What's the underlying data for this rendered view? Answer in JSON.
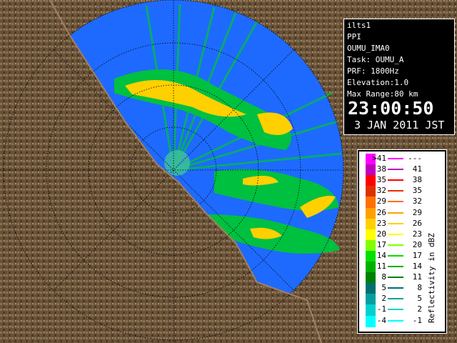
{
  "info": {
    "station": "ilts1",
    "product": "PPI",
    "site": "OUMU_IMA0",
    "task": "Task: OUMU_A",
    "prf": "PRF: 1800Hz",
    "elevation": "Elevation:1.0",
    "max_range": "Max Range:80 km",
    "time": "23:00:50",
    "date": "3 JAN 2011 JST"
  },
  "legend": {
    "title": "Reflectivity in dBZ",
    "rows": [
      {
        "low": ">41",
        "high": "---",
        "color": "#ff00ff"
      },
      {
        "low": "38",
        "high": "41",
        "color": "#c000c0"
      },
      {
        "low": "35",
        "high": "38",
        "color": "#ff0000"
      },
      {
        "low": "32",
        "high": "35",
        "color": "#e03000"
      },
      {
        "low": "29",
        "high": "32",
        "color": "#ff7000"
      },
      {
        "low": "26",
        "high": "29",
        "color": "#ffa000"
      },
      {
        "low": "23",
        "high": "26",
        "color": "#ffd000"
      },
      {
        "low": "20",
        "high": "23",
        "color": "#ffff00"
      },
      {
        "low": "17",
        "high": "20",
        "color": "#80ff00"
      },
      {
        "low": "14",
        "high": "17",
        "color": "#00e000"
      },
      {
        "low": "11",
        "high": "14",
        "color": "#00b000"
      },
      {
        "low": "8",
        "high": "11",
        "color": "#008000"
      },
      {
        "low": "5",
        "high": "8",
        "color": "#007070"
      },
      {
        "low": "2",
        "high": "5",
        "color": "#00a0a0"
      },
      {
        "low": "-1",
        "high": "2",
        "color": "#00d0d0"
      },
      {
        "low": "-4",
        "high": "-1",
        "color": "#00ffff"
      }
    ]
  }
}
